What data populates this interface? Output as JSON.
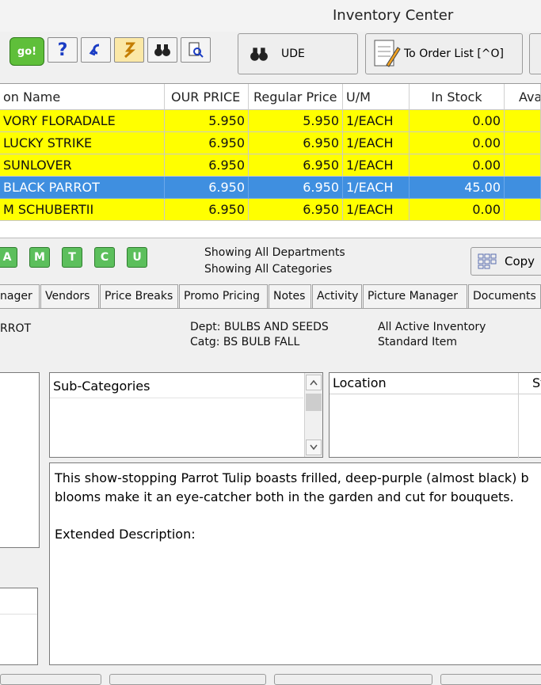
{
  "window": {
    "title": "Inventory Center"
  },
  "toolbar": {
    "go_label": "go!",
    "help_icon": "?",
    "ude_label": "UDE",
    "to_order_list_label": "To Order List [^O]"
  },
  "grid": {
    "columns": [
      "on Name",
      "OUR PRICE",
      "Regular Price",
      "U/M",
      "In Stock",
      "Ava"
    ],
    "rows": [
      {
        "name": "VORY FLORADALE",
        "our_price": "5.950",
        "regular_price": "5.950",
        "um": "1/EACH",
        "in_stock": "0.00",
        "selected": false
      },
      {
        "name": "LUCKY STRIKE",
        "our_price": "6.950",
        "regular_price": "6.950",
        "um": "1/EACH",
        "in_stock": "0.00",
        "selected": false
      },
      {
        "name": "SUNLOVER",
        "our_price": "6.950",
        "regular_price": "6.950",
        "um": "1/EACH",
        "in_stock": "0.00",
        "selected": false
      },
      {
        "name": "BLACK PARROT",
        "our_price": "6.950",
        "regular_price": "6.950",
        "um": "1/EACH",
        "in_stock": "45.00",
        "selected": true
      },
      {
        "name": "M SCHUBERTII",
        "our_price": "6.950",
        "regular_price": "6.950",
        "um": "1/EACH",
        "in_stock": "0.00",
        "selected": false
      }
    ],
    "row_color": "#ffff00",
    "selected_color": "#3f8fe0"
  },
  "filters": {
    "letters": [
      "A",
      "M",
      "T",
      "C",
      "U"
    ],
    "departments_text": "Showing All Departments",
    "categories_text": "Showing All Categories",
    "copy_label": "Copy"
  },
  "tabs": [
    "nager",
    "Vendors",
    "Price Breaks",
    "Promo Pricing",
    "Notes",
    "Activity",
    "Picture Manager",
    "Documents"
  ],
  "detail": {
    "item_name": "RROT",
    "dept": "Dept: BULBS AND SEEDS",
    "catg": "Catg: BS BULB FALL",
    "status": "All Active Inventory",
    "item_type": "Standard Item",
    "subcategories_header": "Sub-Categories",
    "location_header": "Location",
    "location_header2": "St",
    "description_line1": "This show-stopping Parrot Tulip boasts frilled, deep-purple (almost black) b",
    "description_line2": "blooms make it an eye-catcher both in the garden and cut for bouquets.",
    "extended_label": "Extended Description:"
  }
}
